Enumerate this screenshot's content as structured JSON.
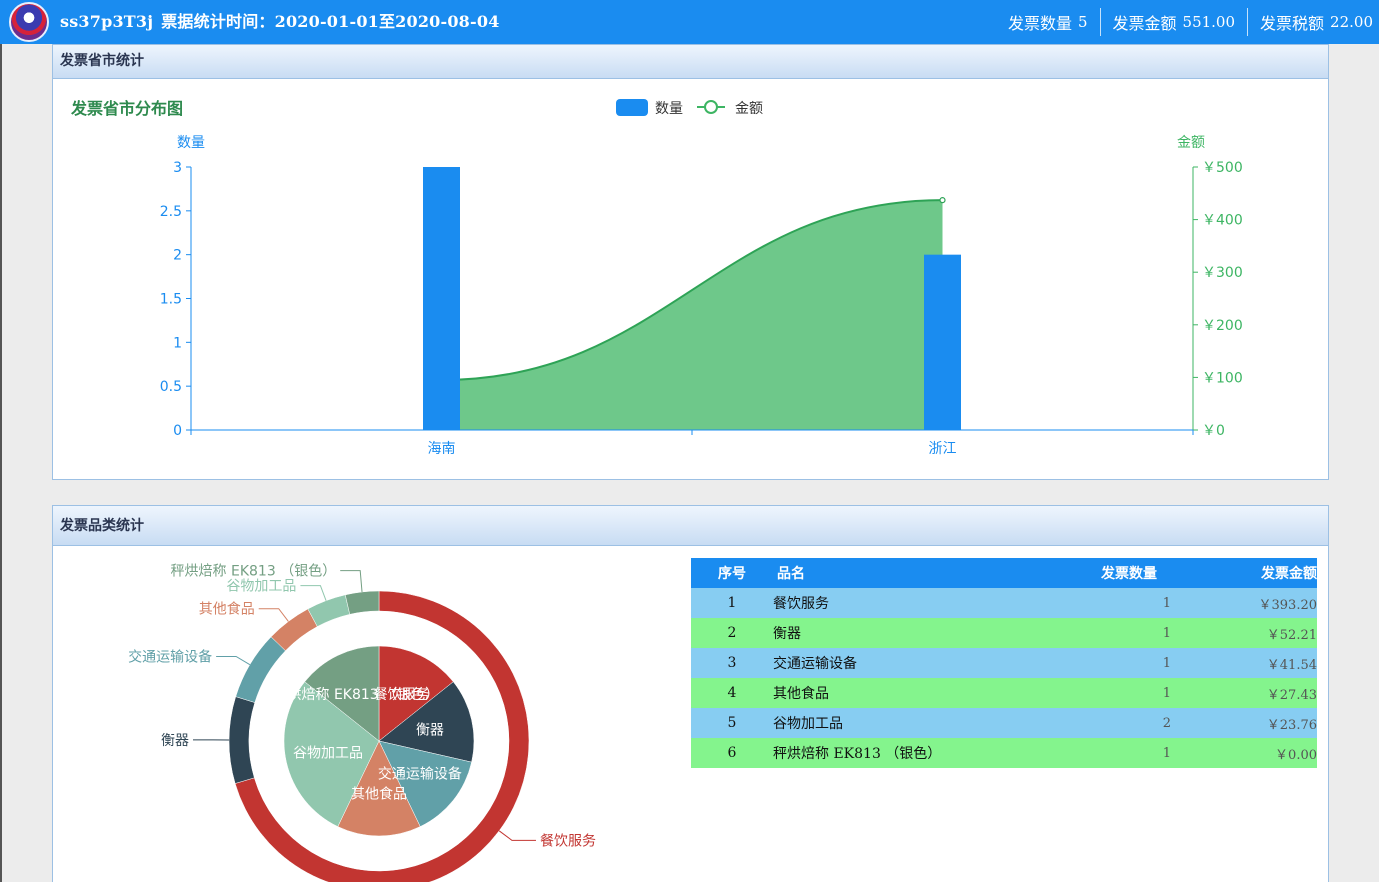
{
  "header": {
    "user_code": "ss37p3T3j",
    "period_label": "票据统计时间：2020-01-01至2020-08-04",
    "stats": [
      {
        "label": "发票数量",
        "value": "5"
      },
      {
        "label": "发票金额",
        "value": "551.00"
      },
      {
        "label": "发票税额",
        "value": "22.00"
      }
    ]
  },
  "province_panel": {
    "title": "发票省市统计"
  },
  "category_panel": {
    "title": "发票品类统计",
    "table": {
      "headers": [
        "序号",
        "品名",
        "发票数量",
        "发票金额"
      ],
      "rows": [
        [
          "1",
          "餐饮服务",
          "1",
          "￥393.20"
        ],
        [
          "2",
          "衡器",
          "1",
          "￥52.21"
        ],
        [
          "3",
          "交通运输设备",
          "1",
          "￥41.54"
        ],
        [
          "4",
          "其他食品",
          "1",
          "￥27.43"
        ],
        [
          "5",
          "谷物加工品",
          "2",
          "￥23.76"
        ],
        [
          "6",
          "秤烘焙称 EK813 （银色）",
          "1",
          "￥0.00"
        ]
      ]
    }
  },
  "colors": {
    "header_blue": "#1a8cf0",
    "bar_blue": "#1a8cf0",
    "area_green": "#3db563",
    "row_blue": "#87cdf2",
    "row_green": "#84f48d"
  },
  "chart_data": [
    {
      "type": "bar+area",
      "title": "发票省市分布图",
      "categories": [
        "海南",
        "浙江"
      ],
      "series": [
        {
          "name": "数量",
          "type": "bar",
          "axis": "left",
          "values": [
            3,
            2
          ]
        },
        {
          "name": "金额",
          "type": "area",
          "axis": "right",
          "values": [
            95,
            437
          ]
        }
      ],
      "ylabel": "数量",
      "y2label": "金额",
      "ylim": [
        0,
        3
      ],
      "yticks": [
        "0",
        "0.5",
        "1",
        "1.5",
        "2",
        "2.5",
        "3"
      ],
      "y2lim": [
        0,
        500
      ],
      "y2ticks": [
        "￥0",
        "￥100",
        "￥200",
        "￥300",
        "￥400",
        "￥500"
      ],
      "legend": "top-center",
      "grid": false
    },
    {
      "type": "pie",
      "title": "",
      "outer_ring": [
        {
          "name": "餐饮服务",
          "value": 393.2,
          "color": "#c23531"
        },
        {
          "name": "衡器",
          "value": 52.21,
          "color": "#2f4554"
        },
        {
          "name": "交通运输设备",
          "value": 41.54,
          "color": "#61a0a8"
        },
        {
          "name": "其他食品",
          "value": 27.43,
          "color": "#d48265"
        },
        {
          "name": "谷物加工品",
          "value": 23.76,
          "color": "#91c7ae"
        },
        {
          "name": "秤烘焙称 EK813 （银色）",
          "value": 0.0,
          "color": "#749f83"
        }
      ],
      "inner_pie": [
        {
          "name": "餐饮服务",
          "value": 1,
          "color": "#c23531"
        },
        {
          "name": "衡器",
          "value": 1,
          "color": "#2f4554"
        },
        {
          "name": "交通运输设备",
          "value": 1,
          "color": "#61a0a8"
        },
        {
          "name": "其他食品",
          "value": 1,
          "color": "#d48265"
        },
        {
          "name": "谷物加工品",
          "value": 2,
          "color": "#91c7ae"
        },
        {
          "name": "秤烘焙称 EK813 （银色）",
          "value": 1,
          "color": "#749f83"
        }
      ],
      "legend": "none"
    }
  ]
}
